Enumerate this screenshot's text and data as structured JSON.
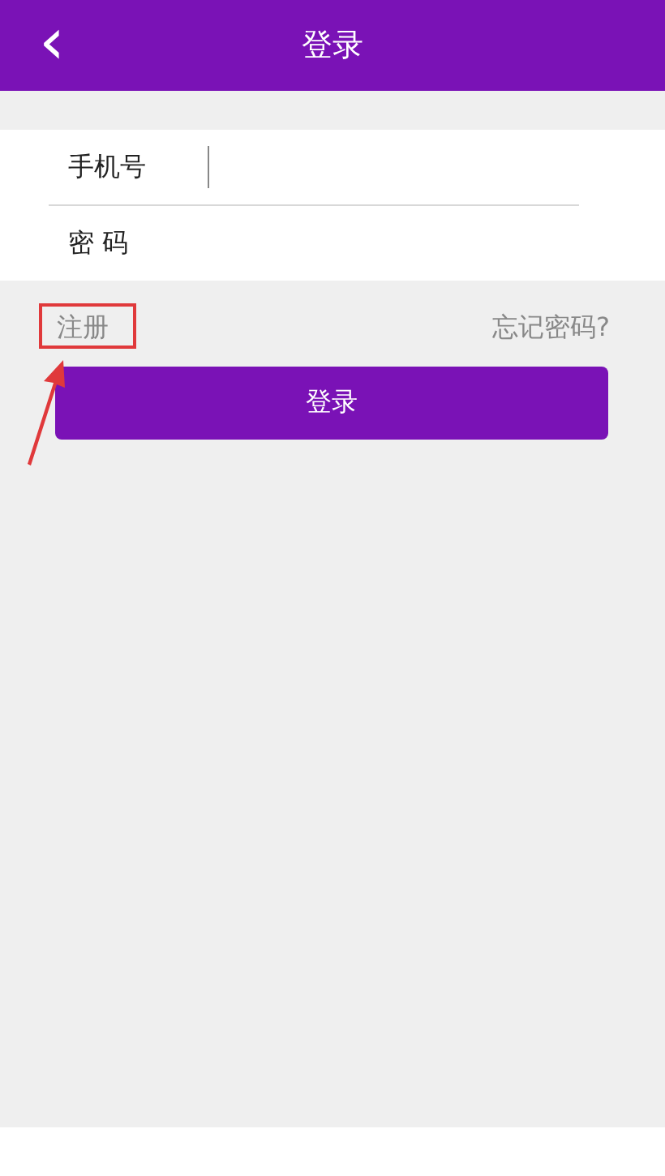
{
  "header": {
    "back": "‹",
    "title": "登录"
  },
  "fields": [
    {
      "label": "手机号",
      "focused": true
    },
    {
      "label": "密 码",
      "focused": false
    }
  ],
  "links": {
    "register": "注册",
    "forgot": "忘记密码?"
  },
  "login_button": "登录"
}
